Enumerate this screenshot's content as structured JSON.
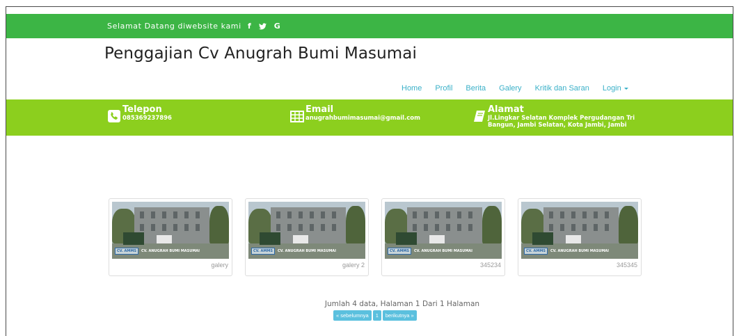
{
  "topbar": {
    "welcome": "Selamat Datang diwebsite kami",
    "social": [
      {
        "icon": "facebook-icon",
        "glyph": "f"
      },
      {
        "icon": "twitter-icon",
        "glyph": "❦"
      },
      {
        "icon": "google-icon",
        "glyph": "G"
      }
    ],
    "color": "#3cb545"
  },
  "site": {
    "title": "Penggajian Cv Anugrah Bumi Masumai"
  },
  "nav": {
    "items": [
      "Home",
      "Profil",
      "Berita",
      "Galery",
      "Kritik dan Saran",
      "Login"
    ],
    "color": "#3ab0c8"
  },
  "contact": {
    "color": "#8ccf1e",
    "phone": {
      "label": "Telepon",
      "value": "085369237896",
      "icon": "phone-icon"
    },
    "email": {
      "label": "Email",
      "value": "anugrahbumimasumai@gmail.com",
      "icon": "table-icon"
    },
    "address": {
      "label": "Alamat",
      "value": "Jl.Lingkar Selatan Komplek Pergudangan Tri Bangun, Jambi Selatan, Kota Jambi, Jambi",
      "icon": "book-icon"
    }
  },
  "gallery": {
    "photo_badge": "CV. AMMS",
    "photo_text": "CV. ANUGRAH BUMI MASUMAI",
    "items": [
      {
        "caption": "galery"
      },
      {
        "caption": "galery 2"
      },
      {
        "caption": "345234"
      },
      {
        "caption": "345345"
      }
    ]
  },
  "pagination": {
    "info": "Jumlah 4 data, Halaman 1 Dari 1 Halaman",
    "prev": "« sebelumnya",
    "page": "1",
    "next": "berikutnya »",
    "color": "#5bc0de"
  }
}
